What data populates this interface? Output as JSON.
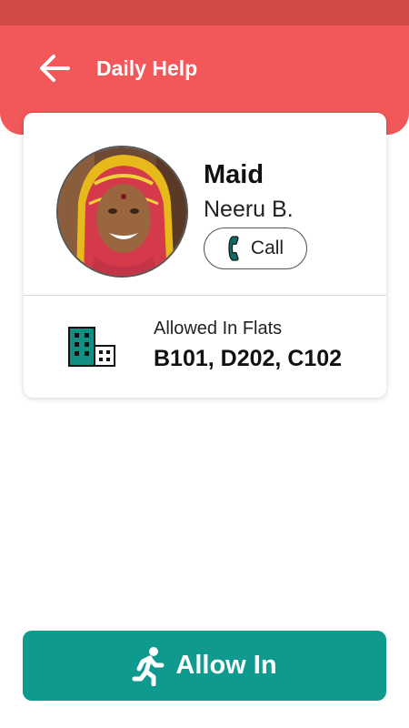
{
  "header": {
    "title": "Daily Help",
    "back_icon": "arrow-left-icon"
  },
  "profile": {
    "role": "Maid",
    "name": "Neeru B.",
    "call_label": "Call",
    "call_icon": "phone-icon"
  },
  "flats": {
    "label": "Allowed In Flats",
    "value": "B101, D202, C102",
    "icon": "building-icon"
  },
  "action": {
    "allow_label": "Allow In",
    "icon": "running-person-icon"
  },
  "colors": {
    "status_bar": "#d14a44",
    "app_bar": "#f2585a",
    "primary_button": "#0e9a8e",
    "building_icon": "#128f82"
  }
}
